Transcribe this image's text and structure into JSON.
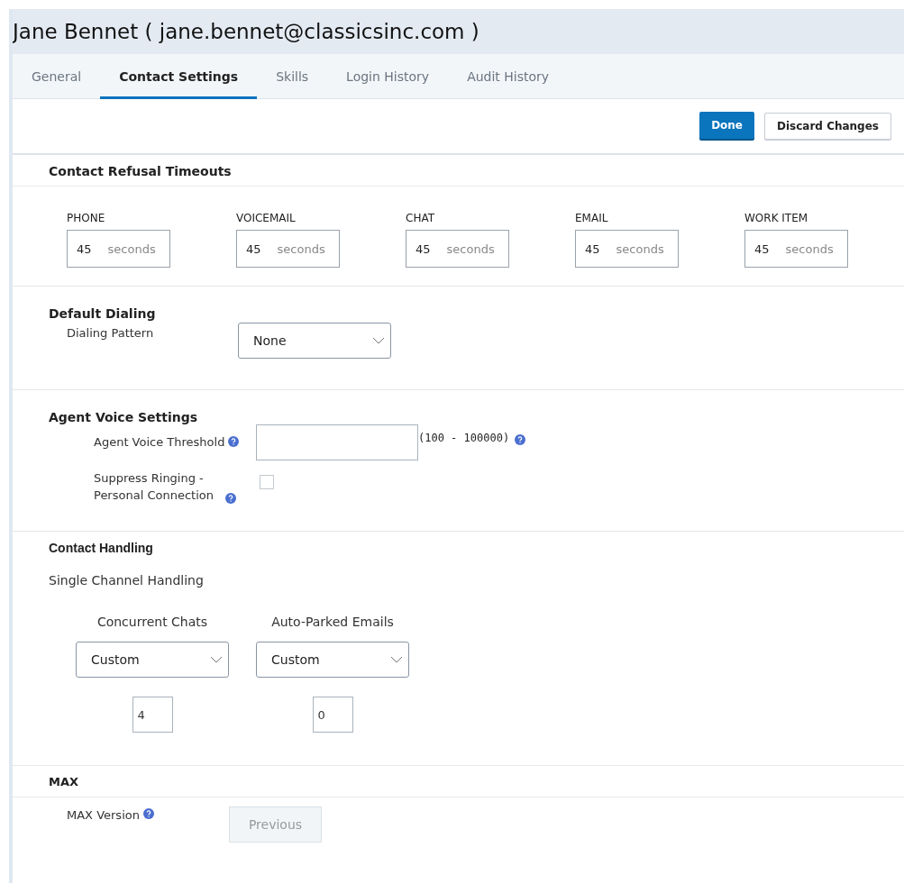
{
  "title": "Jane Bennet ( jane.bennet@classicsinc.com )",
  "tabs": [
    {
      "label": "General",
      "selected": false
    },
    {
      "label": "Contact Settings",
      "selected": true
    },
    {
      "label": "Skills",
      "selected": false
    },
    {
      "label": "Login History",
      "selected": false
    },
    {
      "label": "Audit History",
      "selected": false
    }
  ],
  "actions": {
    "done": "Done",
    "discard": "Discard Changes"
  },
  "refusal_timeouts": {
    "heading": "Contact Refusal Timeouts",
    "channels": [
      {
        "label": "PHONE",
        "value": "45",
        "unit": "seconds"
      },
      {
        "label": "VOICEMAIL",
        "value": "45",
        "unit": "seconds"
      },
      {
        "label": "CHAT",
        "value": "45",
        "unit": "seconds"
      },
      {
        "label": "EMAIL",
        "value": "45",
        "unit": "seconds"
      },
      {
        "label": "WORK ITEM",
        "value": "45",
        "unit": "seconds"
      }
    ]
  },
  "default_dialing": {
    "heading": "Default Dialing",
    "label": "Dialing Pattern",
    "value": "None"
  },
  "agent_voice": {
    "heading": "Agent Voice Settings",
    "threshold_label": "Agent Voice Threshold",
    "range": "(100 - 100000)",
    "suppress_label": "Suppress Ringing - Personal Connection",
    "suppress_checked": false
  },
  "contact_handling": {
    "heading": "Contact Handling",
    "subheading": "Single Channel Handling",
    "columns": [
      {
        "label": "Concurrent Chats",
        "mode": "Custom",
        "value": "4"
      },
      {
        "label": "Auto-Parked Emails",
        "mode": "Custom",
        "value": "0"
      }
    ]
  },
  "max": {
    "heading": "MAX",
    "label": "MAX Version",
    "button": "Previous",
    "button_disabled": true
  }
}
